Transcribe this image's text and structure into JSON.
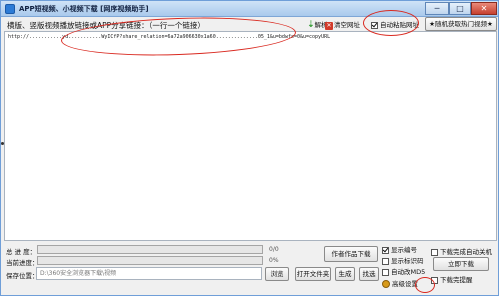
{
  "window": {
    "title": "APP短视频、小视频下载 [网序视频助手]",
    "min_glyph": "─",
    "max_glyph": "□",
    "close_glyph": "✕"
  },
  "toolbar": {
    "prompt": "横版、竖版视频播放链接或APP分享链接：（一行一个链接）",
    "parse_label": "解析",
    "clear_label": "清空网址",
    "auto_label": "自动粘贴网址",
    "auto_checked": true,
    "hot_label": "★随机获取热门视频★"
  },
  "url_input": {
    "value": "http://...........yd...........WyICfP?share_relation=6a72a906630x1a60..............05_1&u=bdwfs=0&u=copyURL"
  },
  "progress": {
    "total_label": "总  进 度：",
    "total_value": "0/0",
    "total_fraction": 0,
    "current_label": "当前进度：",
    "current_value": "0%",
    "current_fraction": 0
  },
  "save": {
    "label": "保存位置：",
    "path": "D:\\360安全浏览器下载\\视频"
  },
  "buttons": {
    "author_works": "作者作品下载",
    "browse": "浏览",
    "open_folder": "打开文件夹",
    "generate": "生成",
    "find": "找选",
    "download_now": "立即下载"
  },
  "options": {
    "show_number": {
      "label": "显示编号",
      "checked": true
    },
    "show_tag": {
      "label": "显示标识码",
      "checked": false
    },
    "auto_md5": {
      "label": "自动改MD5",
      "checked": false
    },
    "advanced": {
      "label": "高级设置"
    },
    "shutdown_after": {
      "label": "下载完成自动关机",
      "checked": false
    },
    "remind_after": {
      "label": "下载完提醒",
      "checked": false
    }
  },
  "colors": {
    "annotation_ring": "#d9281f",
    "progress_fill": "#3aa83a",
    "titlebar": "#a9c9ec"
  }
}
